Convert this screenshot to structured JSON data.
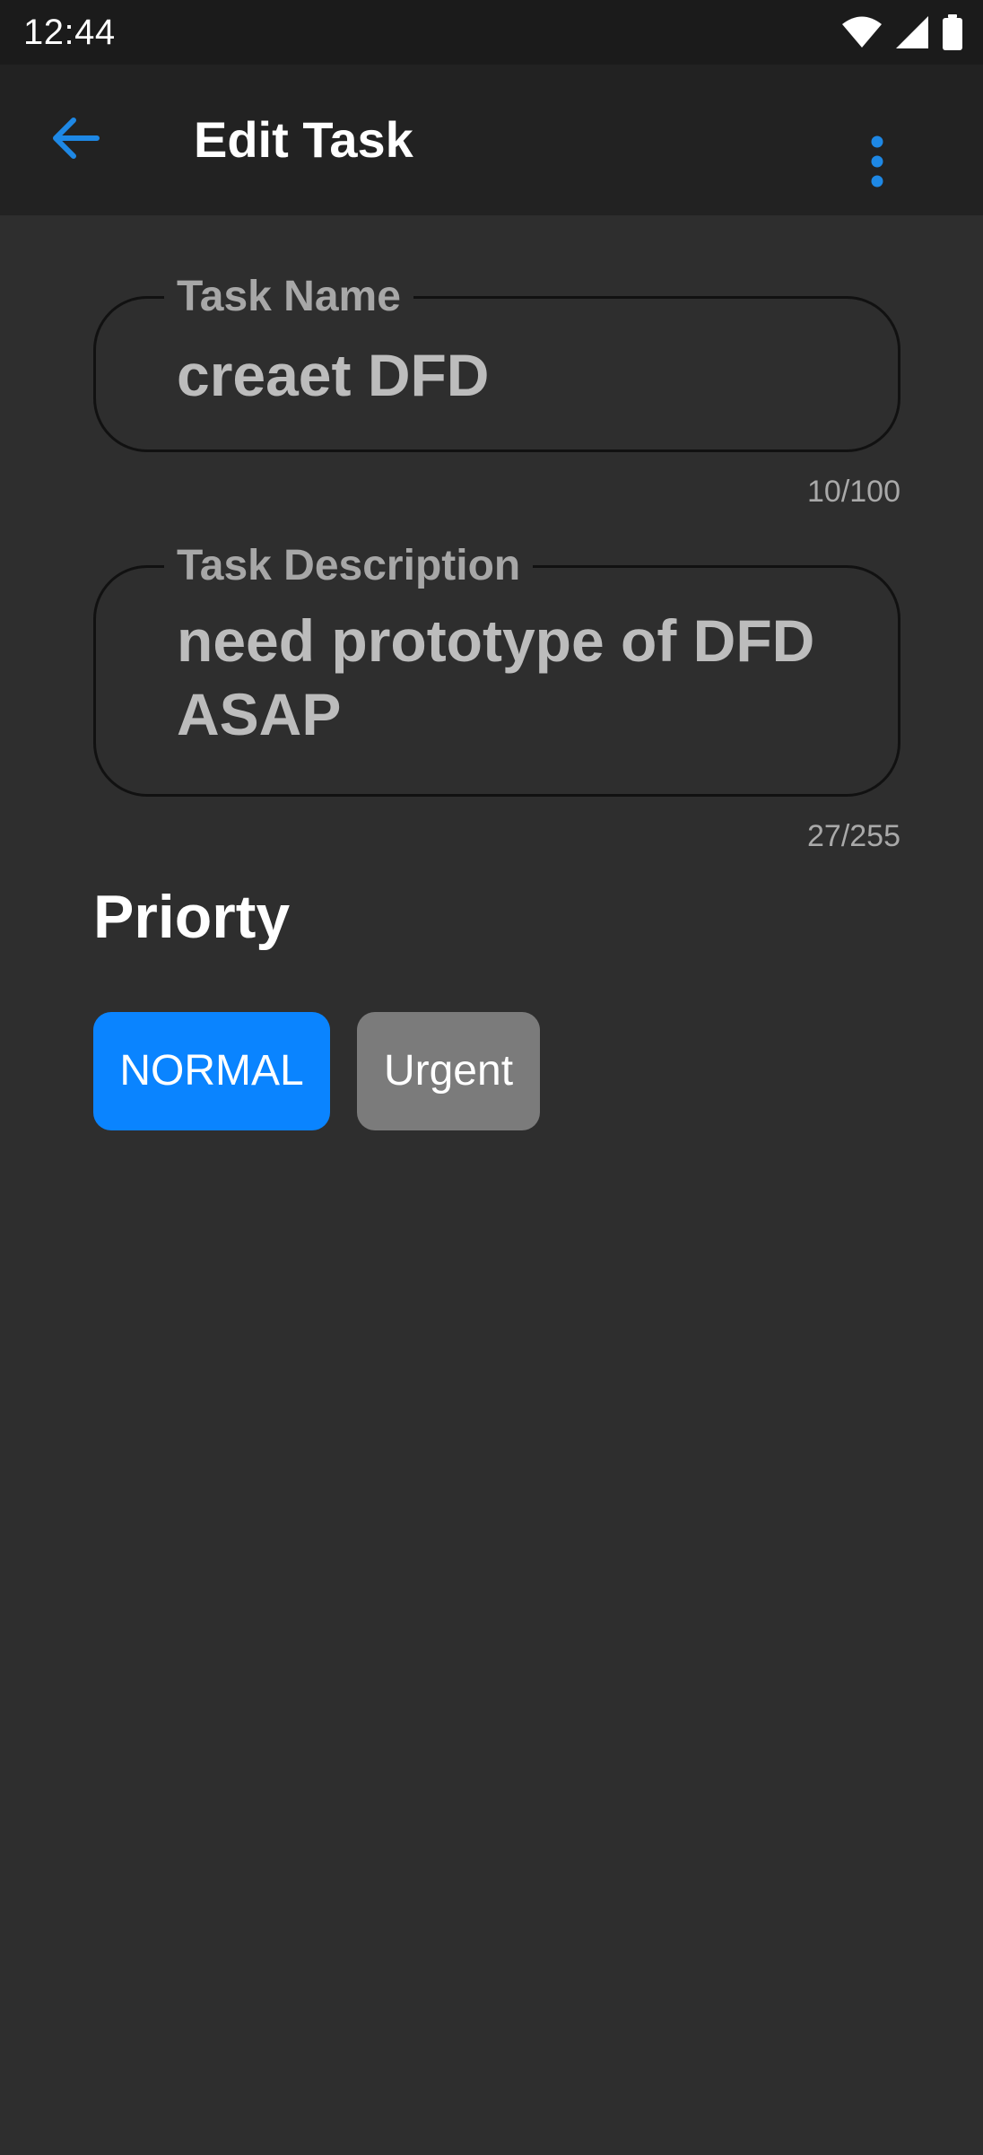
{
  "status_bar": {
    "time": "12:44",
    "icons": [
      "wifi-icon",
      "cell-signal-icon",
      "battery-icon"
    ]
  },
  "app_bar": {
    "title": "Edit Task",
    "back_icon": "arrow-left-icon",
    "menu_icon": "more-vertical-icon"
  },
  "form": {
    "task_name": {
      "label": "Task Name",
      "value": "creaet DFD",
      "counter": "10/100"
    },
    "task_description": {
      "label": "Task Description",
      "value": "need prototype of DFD\nASAP",
      "counter": "27/255"
    },
    "priority": {
      "title": "Priorty",
      "options": [
        "NORMAL",
        "Urgent"
      ],
      "selected": "NORMAL"
    }
  },
  "colors": {
    "accent": "#0a84ff",
    "background": "#2e2e2e",
    "app_bar": "#222222",
    "status_bar": "#1b1b1b",
    "unselected_chip": "#7b7b7b"
  }
}
